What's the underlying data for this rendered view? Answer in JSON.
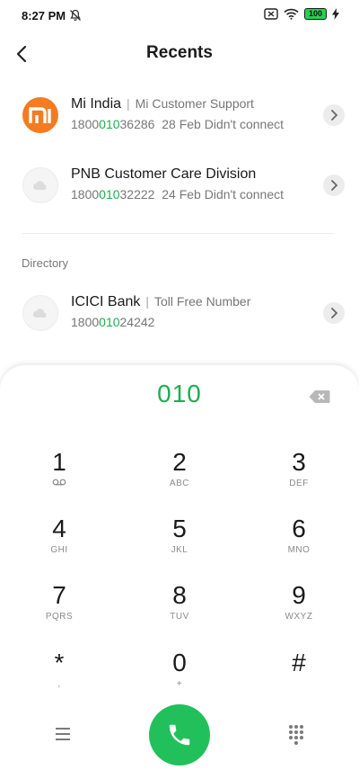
{
  "status": {
    "time": "8:27 PM",
    "battery": "100"
  },
  "header": {
    "title": "Recents"
  },
  "recents": [
    {
      "name": "Mi India",
      "subtitle": "Mi Customer Support",
      "number_pre": "1800",
      "number_match": "010",
      "number_post": "36286",
      "date": "28 Feb",
      "status": "Didn't connect"
    },
    {
      "name": "PNB Customer Care Division",
      "number_pre": "1800",
      "number_match": "010",
      "number_post": "32222",
      "date": "24 Feb",
      "status": "Didn't connect"
    }
  ],
  "directory": {
    "label": "Directory",
    "items": [
      {
        "name": "ICICI Bank",
        "subtitle": "Toll Free Number",
        "number_pre": "1800",
        "number_match": "010",
        "number_post": "24242"
      }
    ]
  },
  "dialpad": {
    "number": "010",
    "keys": [
      {
        "digit": "1",
        "letters": ""
      },
      {
        "digit": "2",
        "letters": "ABC"
      },
      {
        "digit": "3",
        "letters": "DEF"
      },
      {
        "digit": "4",
        "letters": "GHI"
      },
      {
        "digit": "5",
        "letters": "JKL"
      },
      {
        "digit": "6",
        "letters": "MNO"
      },
      {
        "digit": "7",
        "letters": "PQRS"
      },
      {
        "digit": "8",
        "letters": "TUV"
      },
      {
        "digit": "9",
        "letters": "WXYZ"
      },
      {
        "digit": "*",
        "letters": ","
      },
      {
        "digit": "0",
        "letters": "+"
      },
      {
        "digit": "#",
        "letters": ""
      }
    ]
  },
  "colors": {
    "accent_green": "#1dae52",
    "call_button": "#21c05b",
    "mi_orange": "#f47b20"
  },
  "icons": {
    "back": "chevron-left-icon",
    "voicemail": "voicemail-icon",
    "backspace": "backspace-icon",
    "menu": "menu-icon",
    "call": "phone-icon",
    "dialpad_toggle": "dialpad-icon"
  }
}
